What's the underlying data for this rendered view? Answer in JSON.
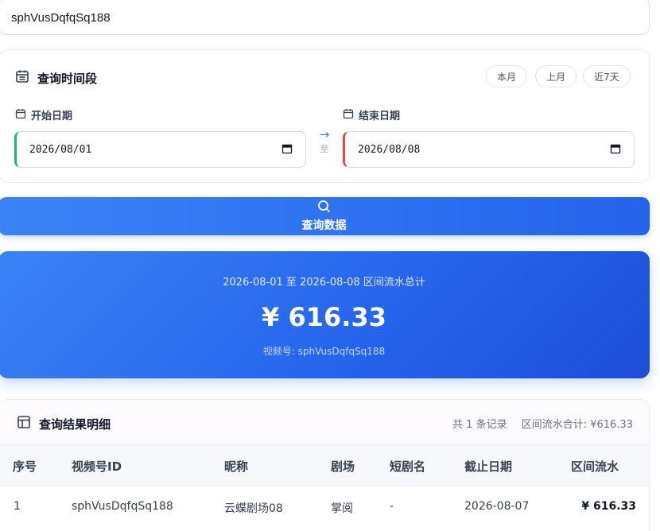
{
  "account_input": {
    "value": "sphVusDqfqSq188"
  },
  "range": {
    "title": "查询时间段",
    "quick": [
      "本月",
      "上月",
      "近7天"
    ],
    "start_label": "开始日期",
    "end_label": "结束日期",
    "start_value": "2026/08/01",
    "end_value": "2026/08/08",
    "to_label": "至"
  },
  "query_button": {
    "label": "查询数据"
  },
  "total": {
    "period": "2026-08-01 至 2026-08-08 区间流水总计",
    "amount": "¥ 616.33",
    "account": "视频号: sphVusDqfqSq188"
  },
  "results": {
    "title": "查询结果明细",
    "record_count": "共 1 条记录",
    "sum_label": "区间流水合计: ¥616.33",
    "columns": [
      "序号",
      "视频号ID",
      "昵称",
      "剧场",
      "短剧名",
      "截止日期",
      "区间流水"
    ],
    "rows": [
      [
        "1",
        "sphVusDqfqSq188",
        "云蝶剧场08",
        "掌阅",
        "-",
        "2026-08-07",
        "¥ 616.33"
      ]
    ]
  },
  "colors": {
    "accent": "#2563eb",
    "start_marker": "#10b981",
    "end_marker": "#ef4444"
  },
  "icons": [
    "calendar-icon",
    "search-icon",
    "table-icon",
    "arrow-right-icon"
  ]
}
